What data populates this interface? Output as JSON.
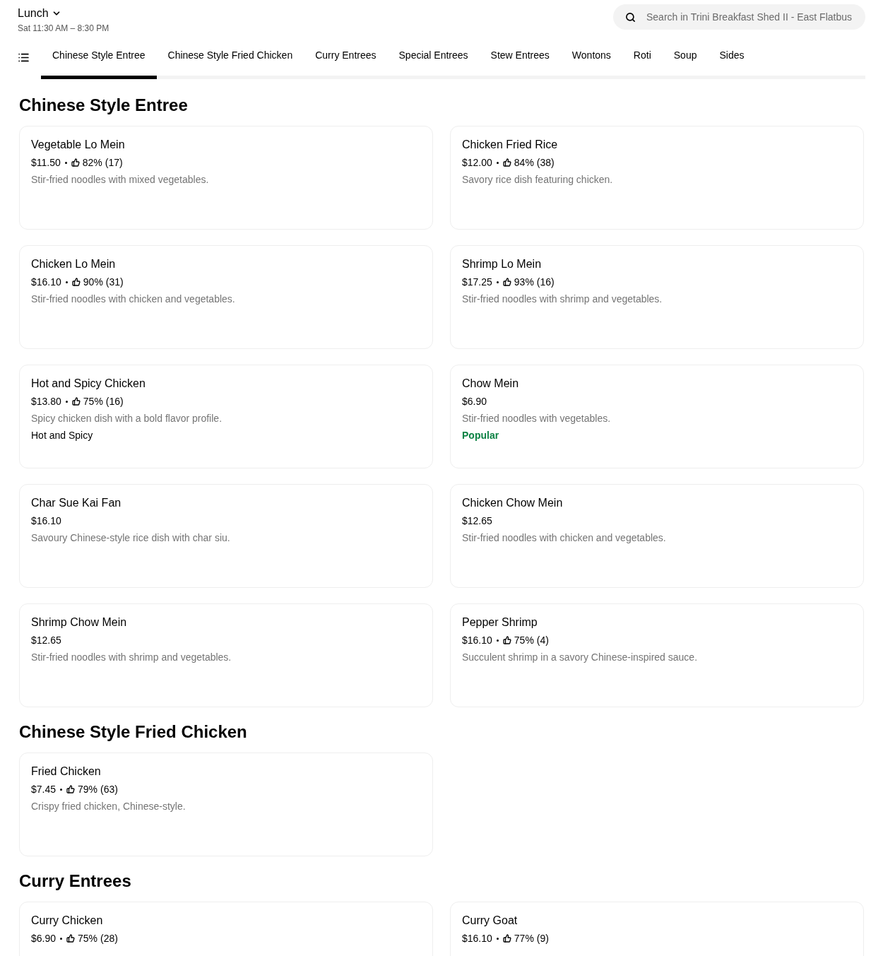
{
  "menu": {
    "title": "Lunch",
    "hours": "Sat 11:30 AM – 8:30 PM"
  },
  "search": {
    "placeholder": "Search in Trini Breakfast Shed II - East Flatbus"
  },
  "tabs": [
    {
      "label": "Chinese Style Entree",
      "selected": true
    },
    {
      "label": "Chinese Style Fried Chicken",
      "selected": false
    },
    {
      "label": "Curry Entrees",
      "selected": false
    },
    {
      "label": "Special Entrees",
      "selected": false
    },
    {
      "label": "Stew Entrees",
      "selected": false
    },
    {
      "label": "Wontons",
      "selected": false
    },
    {
      "label": "Roti",
      "selected": false
    },
    {
      "label": "Soup",
      "selected": false
    },
    {
      "label": "Sides",
      "selected": false
    }
  ],
  "sections": [
    {
      "title": "Chinese Style Entree",
      "items": [
        {
          "name": "Vegetable Lo Mein",
          "price": "$11.50",
          "rating": "82%",
          "count": "(17)",
          "description": "Stir-fried noodles with mixed vegetables."
        },
        {
          "name": "Chicken Fried Rice",
          "price": "$12.00",
          "rating": "84%",
          "count": "(38)",
          "description": "Savory rice dish featuring chicken."
        },
        {
          "name": "Chicken Lo Mein",
          "price": "$16.10",
          "rating": "90%",
          "count": "(31)",
          "description": "Stir-fried noodles with chicken and vegetables."
        },
        {
          "name": "Shrimp Lo Mein",
          "price": "$17.25",
          "rating": "93%",
          "count": "(16)",
          "description": "Stir-fried noodles with shrimp and vegetables."
        },
        {
          "name": "Hot and Spicy Chicken",
          "price": "$13.80",
          "rating": "75%",
          "count": "(16)",
          "description": "Spicy chicken dish with a bold flavor profile.",
          "tag": {
            "text": "Hot and Spicy",
            "kind": "plain"
          }
        },
        {
          "name": "Chow Mein",
          "price": "$6.90",
          "description": "Stir-fried noodles with vegetables.",
          "tag": {
            "text": "Popular",
            "kind": "popular"
          }
        },
        {
          "name": "Char Sue Kai Fan",
          "price": "$16.10",
          "description": "Savoury Chinese-style rice dish with char siu."
        },
        {
          "name": "Chicken Chow Mein",
          "price": "$12.65",
          "description": "Stir-fried noodles with chicken and vegetables."
        },
        {
          "name": "Shrimp Chow Mein",
          "price": "$12.65",
          "description": "Stir-fried noodles with shrimp and vegetables."
        },
        {
          "name": "Pepper Shrimp",
          "price": "$16.10",
          "rating": "75%",
          "count": "(4)",
          "description": "Succulent shrimp in a savory Chinese-inspired sauce."
        }
      ]
    },
    {
      "title": "Chinese Style Fried Chicken",
      "items": [
        {
          "name": "Fried Chicken",
          "price": "$7.45",
          "rating": "79%",
          "count": "(63)",
          "description": "Crispy fried chicken, Chinese-style."
        }
      ]
    },
    {
      "title": "Curry Entrees",
      "items": [
        {
          "name": "Curry Chicken",
          "price": "$6.90",
          "rating": "75%",
          "count": "(28)"
        },
        {
          "name": "Curry Goat",
          "price": "$16.10",
          "rating": "77%",
          "count": "(9)"
        }
      ]
    }
  ]
}
